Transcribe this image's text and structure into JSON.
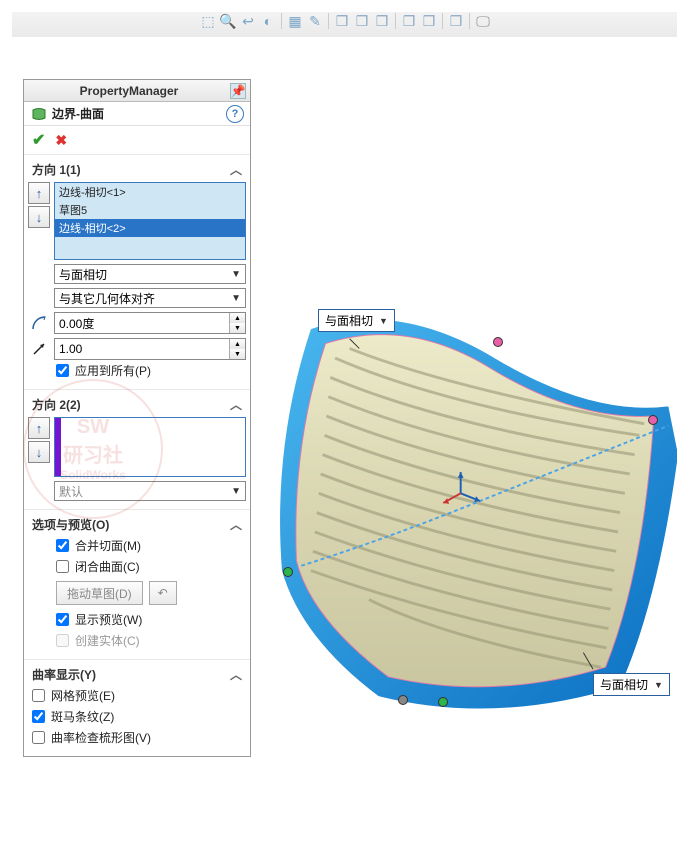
{
  "panel_title": "PropertyManager",
  "feature": {
    "name": "边界-曲面"
  },
  "dir1": {
    "title": "方向 1(1)",
    "items": [
      "边线-相切<1>",
      "草图5",
      "边线-相切<2>"
    ],
    "selected_index": 2,
    "tangent_type": "与面相切",
    "align": "与其它几何体对齐",
    "angle": "0.00度",
    "influence": "1.00",
    "apply_all": "应用到所有(P)"
  },
  "dir2": {
    "title": "方向 2(2)",
    "tangent_type": "默认"
  },
  "options": {
    "title": "选项与预览(O)",
    "merge": "合并切面(M)",
    "close": "闭合曲面(C)",
    "drag_sketch": "拖动草图(D)",
    "show_preview": "显示预览(W)",
    "create_solid": "创建实体(C)"
  },
  "curvature": {
    "title": "曲率显示(Y)",
    "mesh_preview": "网格预览(E)",
    "zebra": "斑马条纹(Z)",
    "comb": "曲率检查梳形图(V)"
  },
  "callouts": {
    "top": "与面相切",
    "bottom": "与面相切"
  }
}
